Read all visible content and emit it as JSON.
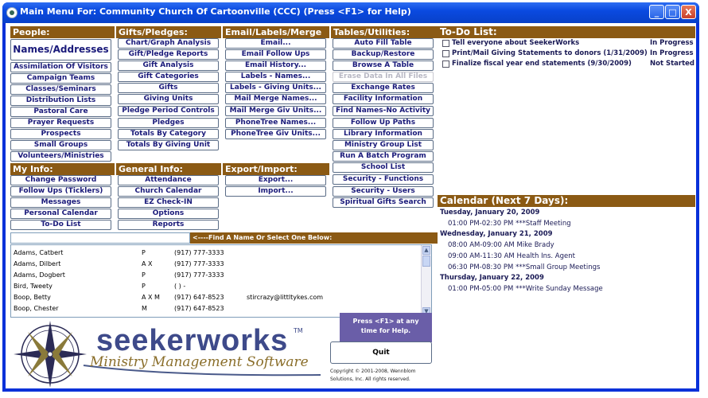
{
  "window": {
    "title": "Main Menu For: Community Church Of Cartoonville (CCC)   (Press <F1> for Help)",
    "controls": [
      "_",
      "□",
      "X"
    ]
  },
  "sections": {
    "people": {
      "header": "People:",
      "items": [
        "Names/Addresses",
        "Assimilation Of Visitors",
        "Campaign Teams",
        "Classes/Seminars",
        "Distribution Lists",
        "Pastoral Care",
        "Prayer Requests",
        "Prospects",
        "Small Groups",
        "Volunteers/Ministries"
      ]
    },
    "gifts": {
      "header": "Gifts/Pledges:",
      "items": [
        "Chart/Graph Analysis",
        "Gift/Pledge Reports",
        "Gift Analysis",
        "Gift Categories",
        "Gifts",
        "Giving Units",
        "Pledge Period Controls",
        "Pledges",
        "Totals By Category",
        "Totals By Giving Unit"
      ]
    },
    "email": {
      "header": "Email/Labels/Merge",
      "items": [
        "Email...",
        "Email Follow Ups",
        "Email History...",
        "Labels - Names...",
        "Labels - Giving Units...",
        "Mail Merge Names...",
        "Mail Merge Giv Units...",
        "PhoneTree Names...",
        "PhoneTree Giv Units..."
      ]
    },
    "tables": {
      "header": "Tables/Utilities:",
      "items": [
        "Auto Fill Table",
        "Backup/Restore",
        "Browse A Table",
        "Erase Data In All Files",
        "Exchange Rates",
        "Facility Information",
        "Find Names-No Activity",
        "Follow Up Paths",
        "Library Information",
        "Ministry Group List",
        "Run A Batch Program",
        "School List",
        "Security - Functions",
        "Security - Users",
        "Spiritual Gifts Search"
      ]
    },
    "myinfo": {
      "header": "My Info:",
      "items": [
        "Change Password",
        "Follow Ups (Ticklers)",
        "Messages",
        "Personal Calendar",
        "To-Do List"
      ]
    },
    "general": {
      "header": "General Info:",
      "items": [
        "Attendance",
        "Church Calendar",
        "EZ Check-IN",
        "Options",
        "Reports"
      ]
    },
    "export": {
      "header": "Export/Import:",
      "items": [
        "Export...",
        "Import..."
      ]
    }
  },
  "find": {
    "label": "<----Find A Name Or Select One Below:",
    "value": ""
  },
  "names": [
    {
      "name": "Adams, Catbert",
      "flags": "P",
      "phone": "(917) 777-3333",
      "email": ""
    },
    {
      "name": "Adams, Dilbert",
      "flags": "A  X",
      "phone": "(917) 777-3333",
      "email": ""
    },
    {
      "name": "Adams, Dogbert",
      "flags": "P",
      "phone": "(917) 777-3333",
      "email": ""
    },
    {
      "name": "Bird, Tweety",
      "flags": "P",
      "phone": "(   )   -",
      "email": ""
    },
    {
      "name": "Boop, Betty",
      "flags": "A  X  M",
      "phone": "(917) 647-8523",
      "email": "stircrazy@littltykes.com"
    },
    {
      "name": "Boop, Chester",
      "flags": "M",
      "phone": "(917) 647-8523",
      "email": ""
    }
  ],
  "logo": {
    "brand": "seekerworks",
    "tm": "TM",
    "tagline": "Ministry Management Software"
  },
  "help_box": {
    "line1": "Press <F1> at any",
    "line2": "time for Help."
  },
  "quit_label": "Quit",
  "copyright": {
    "line1": "Copyright © 2001-2008, Wennblom",
    "line2": "Solutions, Inc.  All rights reserved."
  },
  "todo": {
    "header": "To-Do List:",
    "items": [
      {
        "text": "Tell everyone about SeekerWorks",
        "status": "In Progress"
      },
      {
        "text": "Print/Mail Giving Statements to donors (1/31/2009)",
        "status": "In Progress"
      },
      {
        "text": "Finalize fiscal year end statements (9/30/2009)",
        "status": "Not Started"
      }
    ]
  },
  "calendar": {
    "header": "Calendar (Next 7 Days):",
    "days": [
      {
        "date": "Tuesday, January 20, 2009",
        "events": [
          "01:00 PM-02:30 PM ***Staff Meeting"
        ]
      },
      {
        "date": "Wednesday, January 21, 2009",
        "events": [
          "08:00 AM-09:00 AM Mike Brady",
          "09:00 AM-11:30 AM Health Ins. Agent",
          "06:30 PM-08:30 PM ***Small Group Meetings"
        ]
      },
      {
        "date": "Thursday, January 22, 2009",
        "events": [
          "01:00 PM-05:00 PM ***Write Sunday Message"
        ]
      }
    ]
  },
  "colors": {
    "section_header": "#8b5a14",
    "title_bar": "#0a4ae0",
    "help_box": "#6a5ea8",
    "button_text": "#1a1a7a"
  }
}
